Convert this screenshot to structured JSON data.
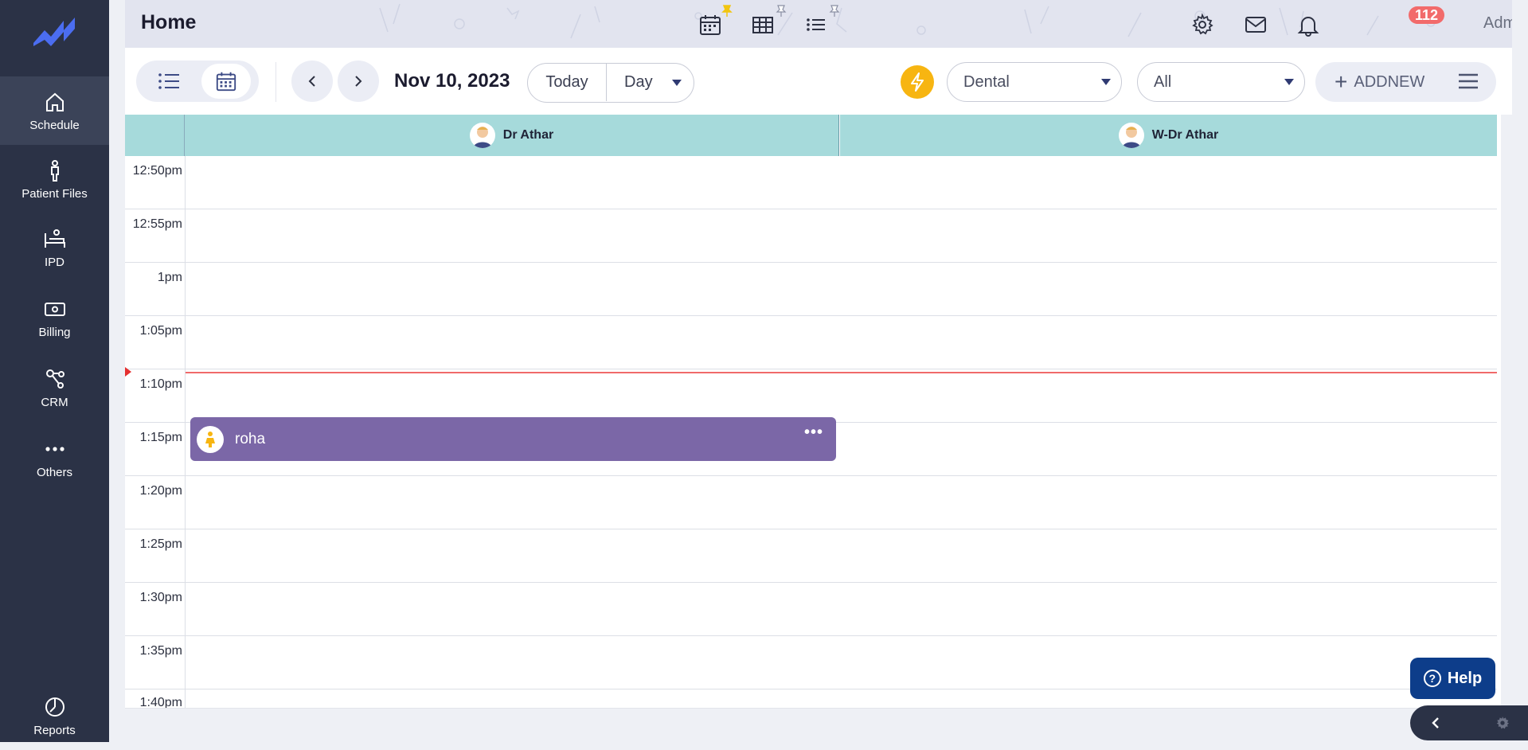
{
  "sidebar": {
    "logo": "trend-logo",
    "items": [
      {
        "label": "Schedule",
        "icon": "home-icon",
        "active": true
      },
      {
        "label": "Patient Files",
        "icon": "person-icon"
      },
      {
        "label": "IPD",
        "icon": "bed-icon"
      },
      {
        "label": "Billing",
        "icon": "money-icon"
      },
      {
        "label": "CRM",
        "icon": "network-icon"
      },
      {
        "label": "Others",
        "icon": "dots-icon"
      },
      {
        "label": "Reports",
        "icon": "pie-chart-icon"
      }
    ]
  },
  "header": {
    "title": "Home",
    "notification_count": "112",
    "user_name": "Administrator",
    "icons": [
      "calendar-icon",
      "grid-icon",
      "list-icon",
      "settings-icon",
      "mail-icon",
      "bell-icon"
    ]
  },
  "toolbar": {
    "date": "Nov 10, 2023",
    "today_label": "Today",
    "view_label": "Day",
    "department": "Dental",
    "filter": "All",
    "addnew_label": "ADDNEW",
    "colors": {
      "bolt": "#f7b511",
      "accent": "#2f3a72"
    }
  },
  "calendar": {
    "columns": [
      {
        "label": "Dr Athar"
      },
      {
        "label": "W-Dr Athar"
      }
    ],
    "times": [
      "12:50pm",
      "12:55pm",
      "1pm",
      "1:05pm",
      "1:10pm",
      "1:15pm",
      "1:20pm",
      "1:25pm",
      "1:30pm",
      "1:35pm",
      "1:40pm"
    ],
    "appointment": {
      "name": "roha",
      "color": "#7b67a7"
    }
  },
  "help": {
    "label": "Help"
  }
}
